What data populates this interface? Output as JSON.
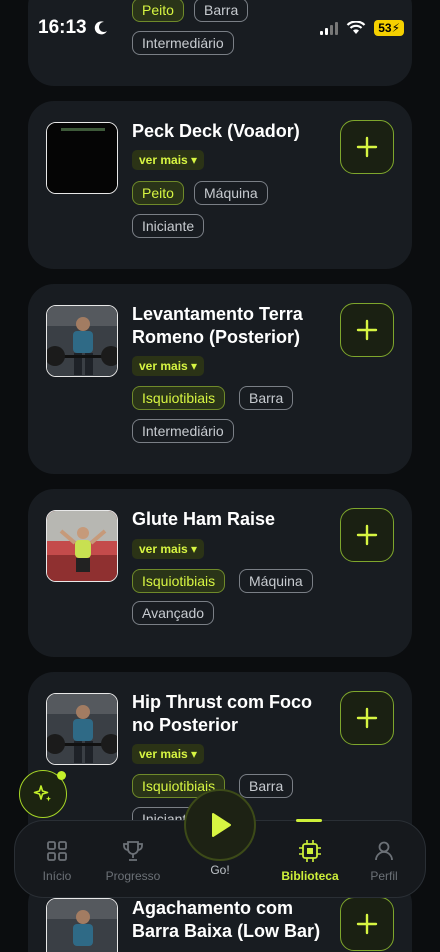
{
  "status": {
    "time": "16:13",
    "battery": "53"
  },
  "cards": [
    {
      "title": "",
      "tags": [
        "Peito",
        "Barra",
        "Intermediário"
      ]
    },
    {
      "title": "Peck Deck (Voador)",
      "more": "ver mais ▾",
      "tags": [
        "Peito",
        "Máquina",
        "Iniciante"
      ]
    },
    {
      "title": "Levantamento Terra Romeno (Posterior)",
      "more": "ver mais ▾",
      "tags": [
        "Isquiotibiais",
        "Barra",
        "Intermediário"
      ]
    },
    {
      "title": "Glute Ham Raise",
      "more": "ver mais ▾",
      "tags": [
        "Isquiotibiais",
        "Máquina",
        "Avançado"
      ]
    },
    {
      "title": "Hip Thrust com Foco no Posterior",
      "more": "ver mais ▾",
      "tags": [
        "Isquiotibiais",
        "Barra",
        "Iniciante"
      ]
    },
    {
      "title": "Agachamento com Barra Baixa (Low Bar)"
    }
  ],
  "nav": {
    "inicio": "Início",
    "progresso": "Progresso",
    "go": "Go!",
    "biblioteca": "Biblioteca",
    "perfil": "Perfil"
  },
  "colors": {
    "accent": "#cdef3a",
    "card": "#181c21",
    "background": "#0b0d0f"
  }
}
